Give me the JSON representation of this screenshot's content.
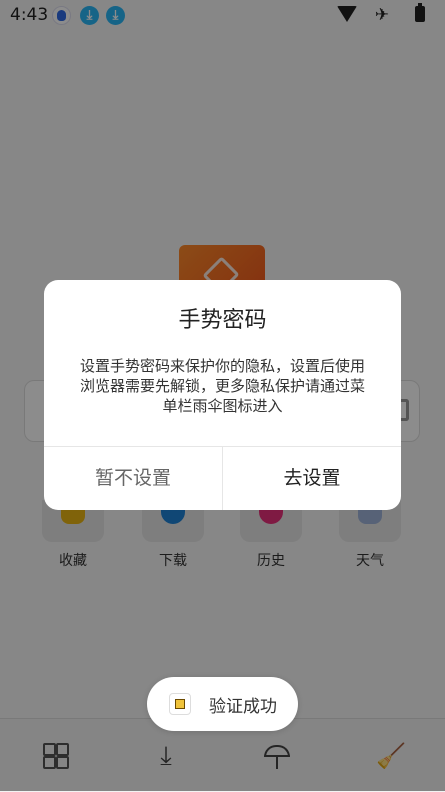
{
  "status_bar": {
    "time": "4:43",
    "notifications": [
      "baidu-icon",
      "download-icon",
      "download-icon"
    ],
    "system_icons": [
      "wifi-icon",
      "airplane-icon",
      "battery-icon"
    ]
  },
  "shortcuts": [
    {
      "label": "收藏",
      "icon": "favorites-icon"
    },
    {
      "label": "下载",
      "icon": "download-icon"
    },
    {
      "label": "历史",
      "icon": "history-icon"
    },
    {
      "label": "天气",
      "icon": "weather-icon"
    }
  ],
  "dialog": {
    "title": "手势密码",
    "message": "设置手势密码来保护你的隐私，设置后使用浏览器需要先解锁，更多隐私保护请通过菜单栏雨伞图标进入",
    "cancel_label": "暂不设置",
    "confirm_label": "去设置"
  },
  "toast": {
    "text": "验证成功"
  },
  "bottom_nav": [
    "menu-grid-icon",
    "download-icon",
    "umbrella-icon",
    "clean-broom-icon"
  ],
  "colors": {
    "accent_orange": "#f0551c",
    "download_blue": "#29b6f6"
  }
}
